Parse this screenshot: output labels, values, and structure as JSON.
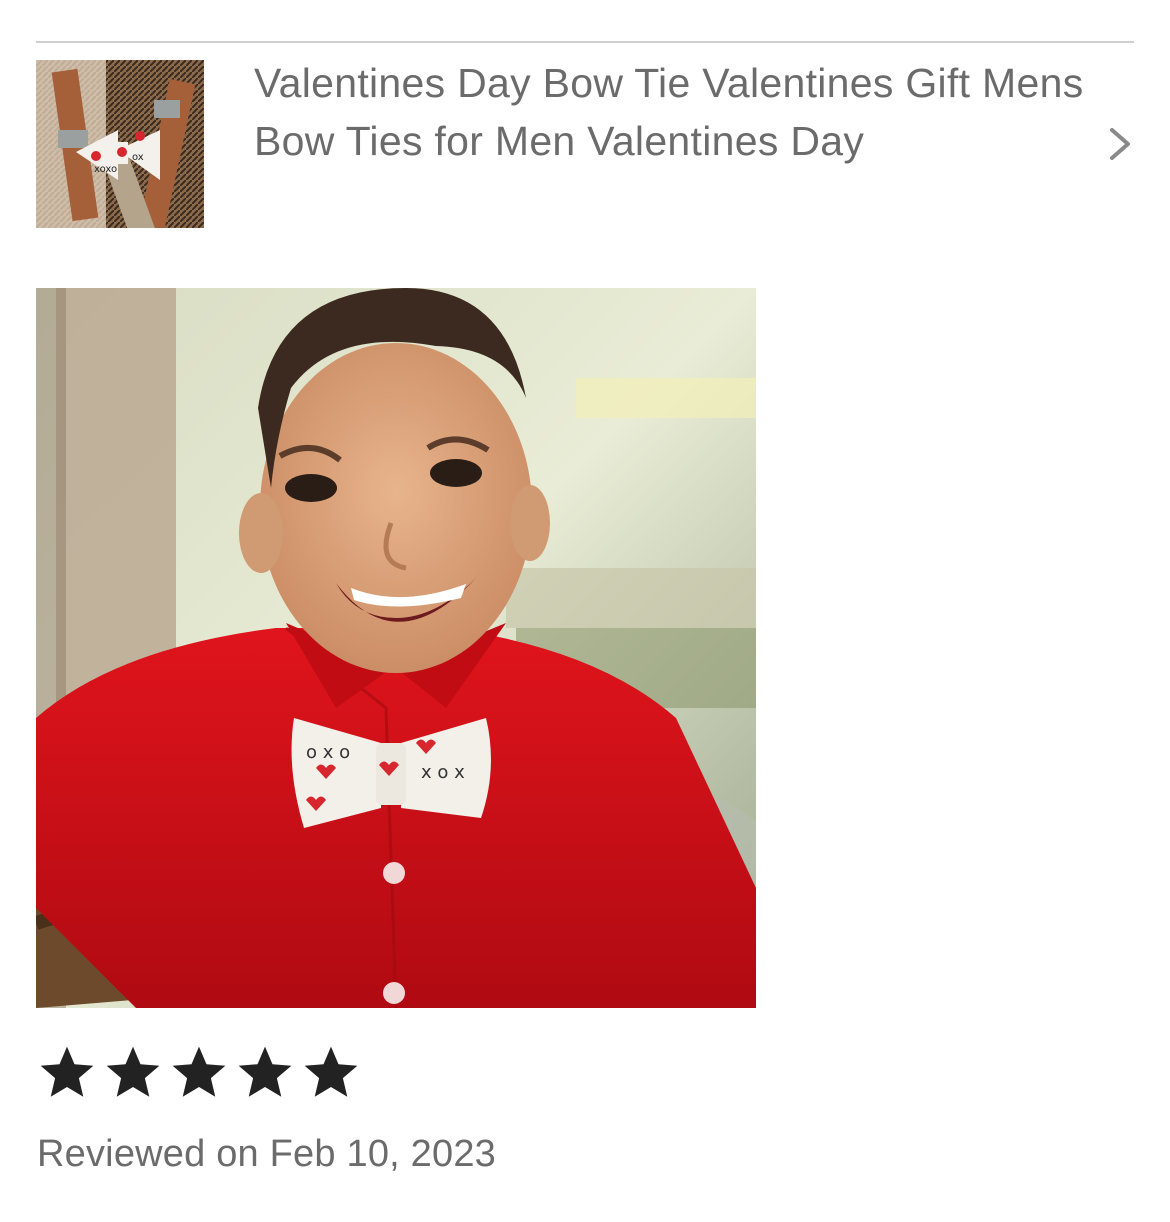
{
  "listing": {
    "title": "Valentines Day Bow Tie Valentines Gift Mens Bow Ties for Men Valentines Day",
    "thumbnail_icon": "product-thumbnail-image",
    "chevron_icon": "chevron-right-icon"
  },
  "review": {
    "photo_icon": "review-photo-image",
    "rating": 5,
    "rating_max": 5,
    "date_text": "Reviewed on Feb 10, 2023"
  },
  "colors": {
    "text_muted": "#6b6b6b",
    "star": "#222222",
    "divider": "#cfcfcf",
    "shirt_red": "#d0101a"
  }
}
